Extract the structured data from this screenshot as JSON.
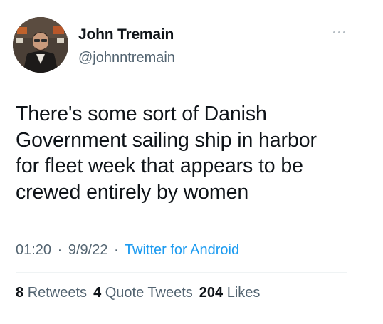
{
  "user": {
    "display_name": "John Tremain",
    "handle": "@johnntremain",
    "avatar_icon": "profile-photo"
  },
  "more_icon": "ellipsis-icon",
  "tweet": {
    "lines": [
      "There's some sort of Danish",
      "Government sailing ship in harbor",
      "for fleet week that appears to be",
      "crewed entirely by women"
    ]
  },
  "meta": {
    "time": "01:20",
    "separator": "·",
    "date": "9/9/22",
    "source": "Twitter for Android"
  },
  "stats": {
    "retweets_count": "8",
    "retweets_label": "Retweets",
    "quotes_count": "4",
    "quotes_label": "Quote Tweets",
    "likes_count": "204",
    "likes_label": "Likes"
  },
  "colors": {
    "text_primary": "#0f1419",
    "text_secondary": "#536471",
    "link": "#1d9bf0",
    "divider": "#eff3f4"
  }
}
